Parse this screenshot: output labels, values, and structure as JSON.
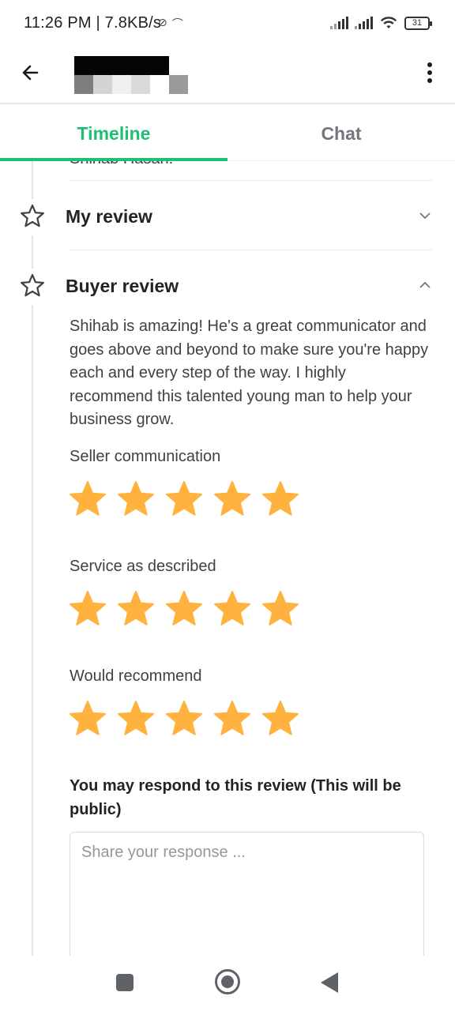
{
  "status_bar": {
    "time": "11:26 PM | 7.8KB/s",
    "battery": "31"
  },
  "header": {
    "back_icon": "arrow-left-icon",
    "title_redacted": true,
    "menu_icon": "more-vertical-icon"
  },
  "tabs": [
    {
      "label": "Timeline",
      "active": true
    },
    {
      "label": "Chat",
      "active": false
    }
  ],
  "timeline": {
    "previous_item_text": "Shihab Hasan!",
    "my_review": {
      "title": "My review",
      "expanded": false
    },
    "buyer_review": {
      "title": "Buyer review",
      "expanded": true,
      "text": "Shihab is amazing! He's a great communicator and goes above and beyond to make sure you're happy each and every step of the way. I highly recommend this talented young man to help your business grow.",
      "ratings": [
        {
          "label": "Seller communication",
          "stars": 5
        },
        {
          "label": "Service as described",
          "stars": 5
        },
        {
          "label": "Would recommend",
          "stars": 5
        }
      ]
    },
    "respond": {
      "title": "You may respond to this review (This will be public)",
      "placeholder": "Share your response ..."
    }
  },
  "colors": {
    "accent": "#1dbf73",
    "star": "#ffb33e",
    "tab_inactive": "#74767e"
  }
}
